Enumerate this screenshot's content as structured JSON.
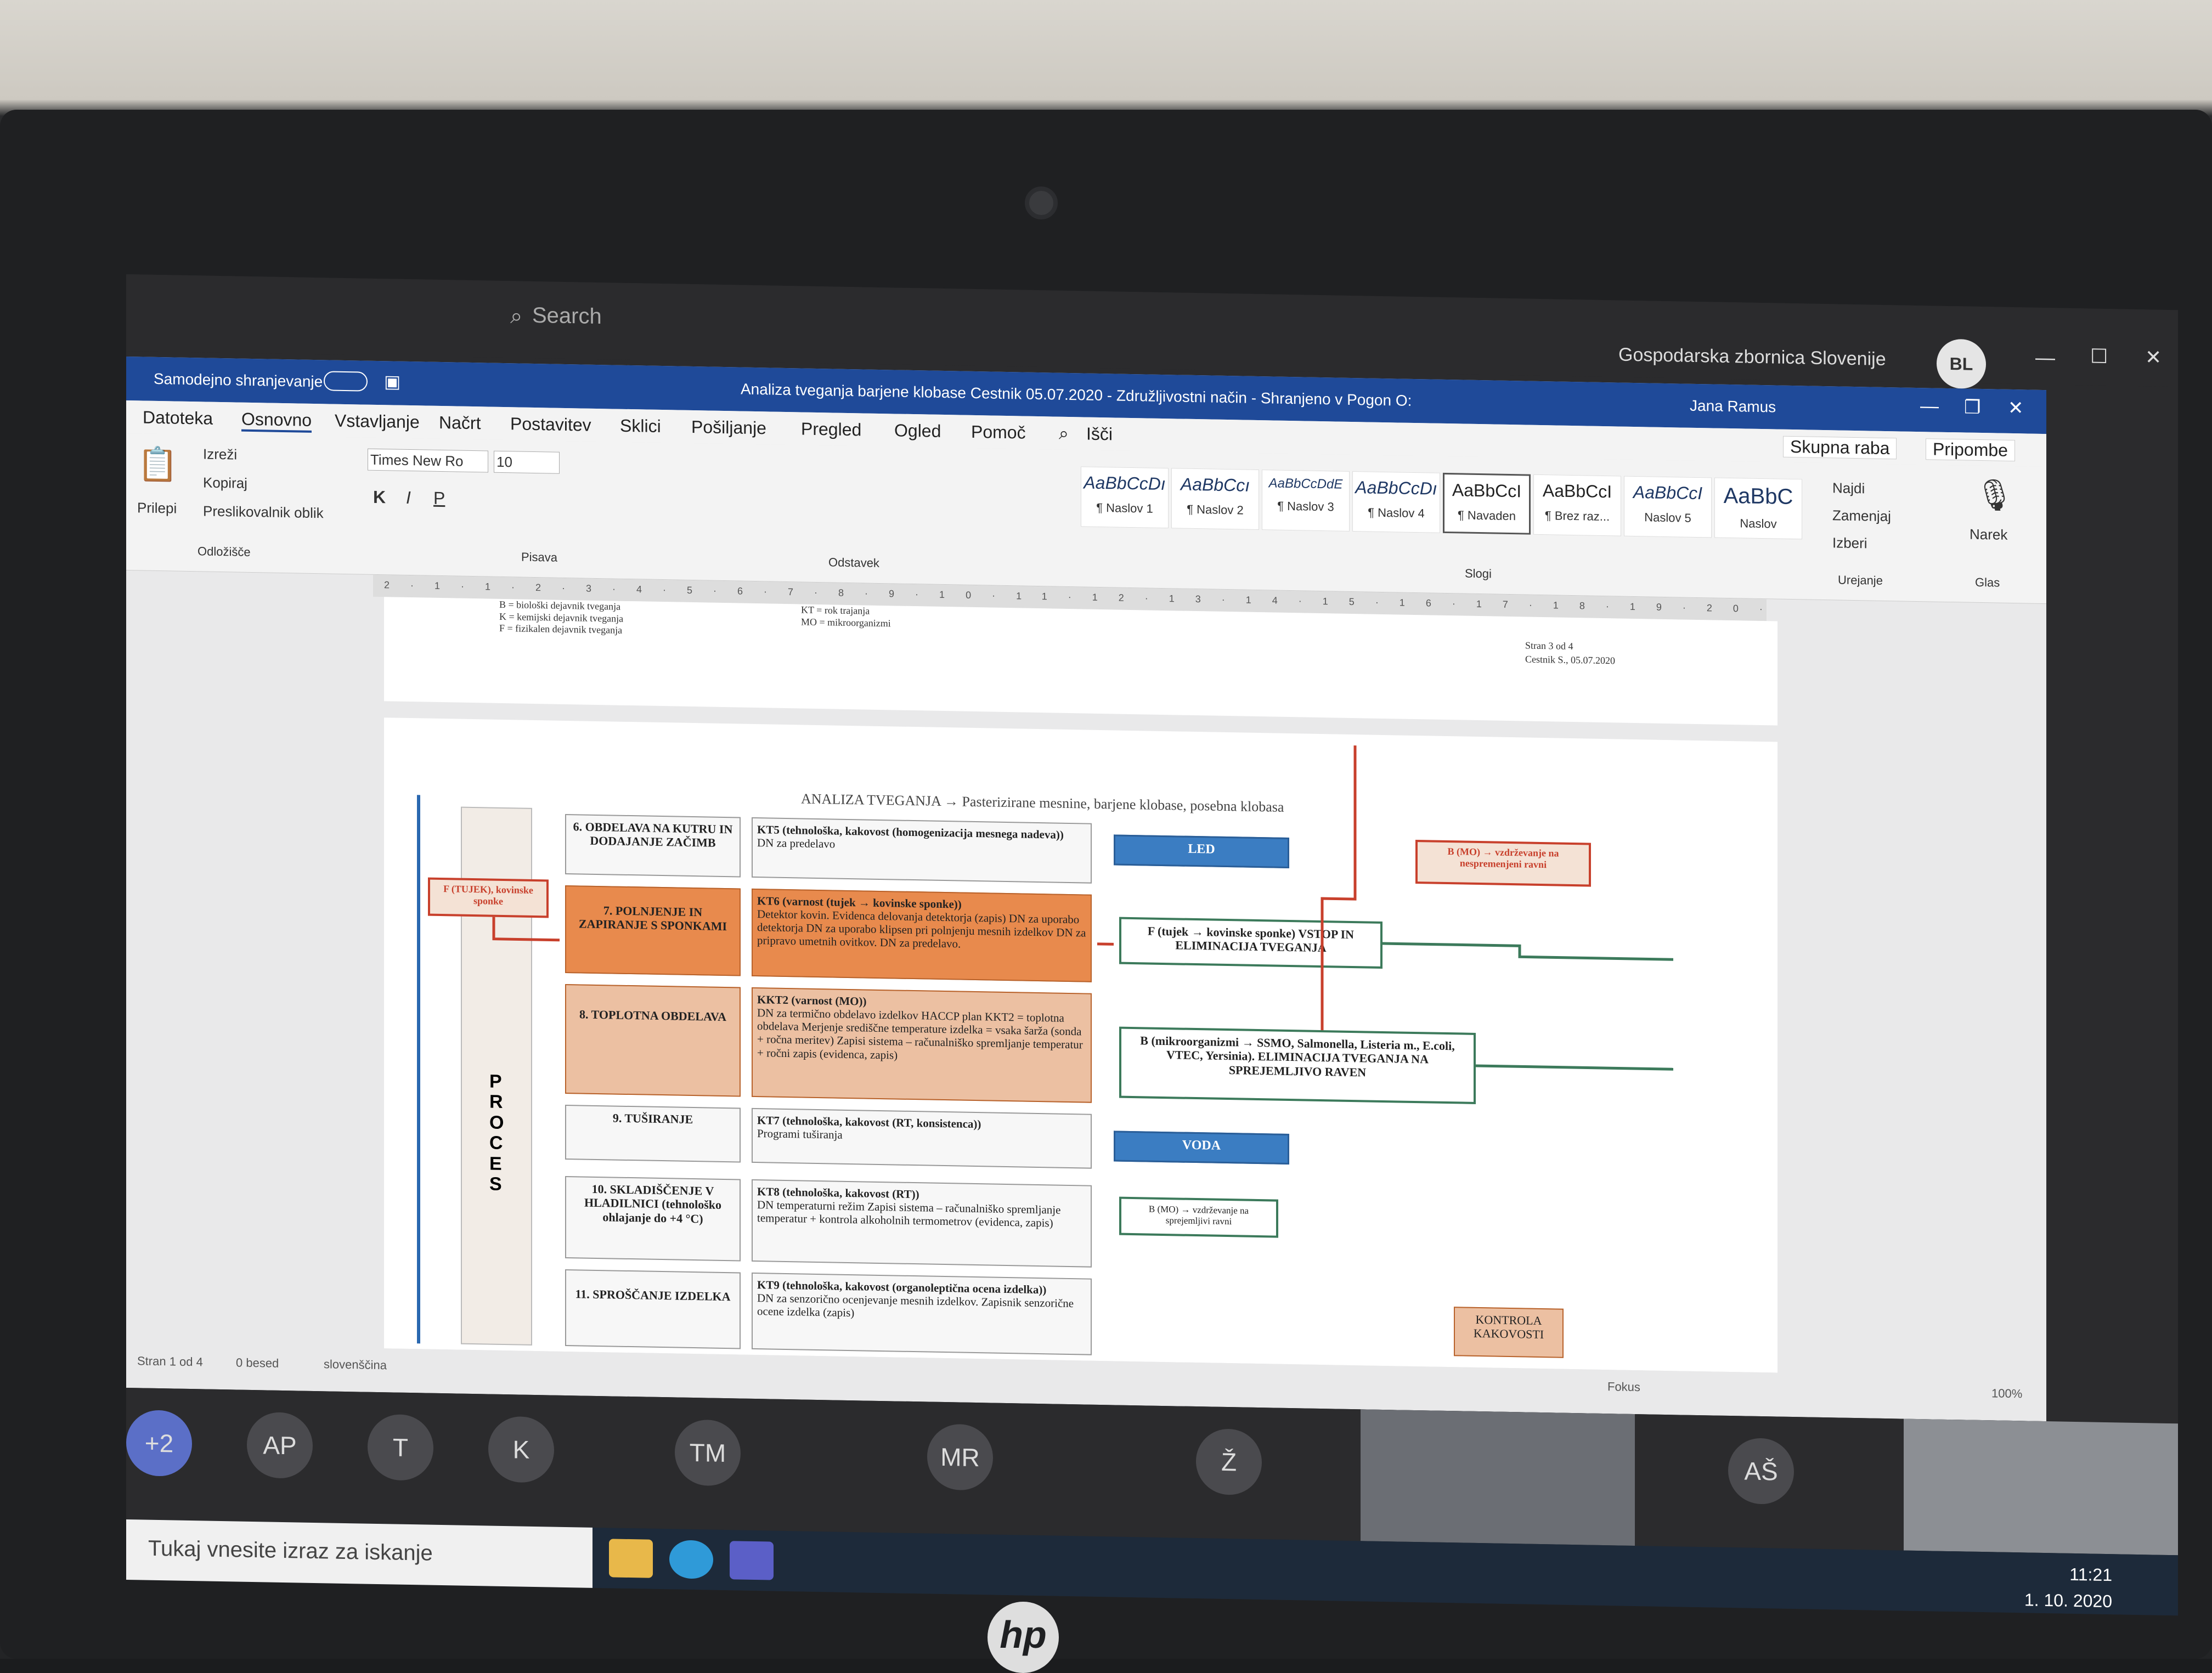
{
  "teams": {
    "search_placeholder": "Search",
    "org_name": "Gospodarska zbornica Slovenije",
    "user_initials": "BL"
  },
  "word": {
    "autosave_label": "Samodejno shranjevanje",
    "doc_title": "Analiza tveganja barjene klobase Cestnik 05.07.2020 - Združljivostni način - Shranjeno v Pogon O:",
    "user_name": "Jana Ramus",
    "menu": [
      "Datoteka",
      "Osnovno",
      "Vstavljanje",
      "Načrt",
      "Postavitev",
      "Sklici",
      "Pošiljanje",
      "Pregled",
      "Ogled",
      "Pomoč",
      "Išči"
    ],
    "share_label": "Skupna raba",
    "comments_label": "Pripombe",
    "clipboard": {
      "paste": "Prilepi",
      "cut": "Izreži",
      "copy": "Kopiraj",
      "format_painter": "Preslikovalnik oblik",
      "group": "Odložišče"
    },
    "font": {
      "name": "Times New Ro",
      "size": "10",
      "group": "Pisava"
    },
    "paragraph_group": "Odstavek",
    "styles": [
      {
        "preview": "AaBbCcDı",
        "name": "¶ Naslov 1"
      },
      {
        "preview": "AaBbCcı",
        "name": "¶ Naslov 2"
      },
      {
        "preview": "AaBbCcDdE",
        "name": "¶ Naslov 3"
      },
      {
        "preview": "AaBbCcDı",
        "name": "¶ Naslov 4"
      },
      {
        "preview": "AaBbCcI",
        "name": "¶ Navaden"
      },
      {
        "preview": "AaBbCcI",
        "name": "¶ Brez raz..."
      },
      {
        "preview": "AaBbCcI",
        "name": "Naslov 5"
      },
      {
        "preview": "AaBbC",
        "name": "Naslov"
      }
    ],
    "styles_group": "Slogi",
    "editing": {
      "find": "Najdi",
      "replace": "Zamenjaj",
      "select": "Izberi",
      "group": "Urejanje"
    },
    "voice": {
      "dictate": "Narek",
      "group": "Glas"
    },
    "page1": {
      "legend": [
        "B = biološki dejavnik tveganja",
        "K = kemijski dejavnik tveganja",
        "F = fizikalen dejavnik tveganja"
      ],
      "legend2": [
        "KT = rok trajanja",
        "MO = mikroorganizmi"
      ],
      "page_info": "Stran 3 od 4",
      "author_date": "Cestnik S., 05.07.2020"
    },
    "diagram": {
      "title": "ANALIZA TVEGANJA → Pasterizirane mesnine, barjene klobase, posebna klobasa",
      "process_label": "P R O C E S",
      "steps": [
        "6. OBDELAVA NA KUTRU IN DODAJANJE ZAČIMB",
        "7. POLNJENJE IN ZAPIRANJE S SPONKAMI",
        "8. TOPLOTNA OBDELAVA",
        "9. TUŠIRANJE",
        "10. SKLADIŠČENJE V HLADILNICI (tehnološko ohlajanje do +4 °C)",
        "11. SPROŠČANJE IZDELKA"
      ],
      "kt": [
        {
          "title": "KT5 (tehnološka, kakovost (homogenizacija mesnega nadeva))",
          "body": "DN za predelavo"
        },
        {
          "title": "KT6 (varnost (tujek → kovinske sponke))",
          "body": "Detektor kovin. Evidenca delovanja detektorja (zapis) DN za uporabo detektorja DN za uporabo klipsen pri polnjenju mesnih izdelkov DN za pripravo umetnih ovitkov. DN za predelavo."
        },
        {
          "title": "KKT2 (varnost (MO))",
          "body": "DN za termično obdelavo izdelkov HACCP plan KKT2 = toplotna obdelava Merjenje središčne temperature izdelka = vsaka šarža (sonda + ročna meritev) Zapisi sistema – računalniško spremljanje temperatur + ročni zapis (evidenca, zapis)"
        },
        {
          "title": "KT7 (tehnološka, kakovost (RT, konsistenca))",
          "body": "Programi tuširanja"
        },
        {
          "title": "KT8 (tehnološka, kakovost (RT))",
          "body": "DN temperaturni režim Zapisi sistema – računalniško spremljanje temperatur + kontrola alkoholnih termometrov (evidenca, zapis)"
        },
        {
          "title": "KT9 (tehnološka, kakovost (organoleptična ocena izdelka))",
          "body": "DN za senzorično ocenjevanje mesnih izdelkov. Zapisnik senzorične ocene izdelka (zapis)"
        }
      ],
      "hazard_left": "F (TUJEK), kovinske sponke",
      "led": "LED",
      "voda": "VODA",
      "f_box": "F (tujek → kovinske sponke) VSTOP IN ELIMINACIJA TVEGANJA",
      "b_box": "B (mikroorganizmi → SSMO, Salmonella, Listeria m., E.coli, VTEC, Yersinia). ELIMINACIJA TVEGANJA NA SPREJEMLJIVO RAVEN",
      "b_mo_top": "B (MO) → vzdrževanje na nespremenjeni ravni",
      "b_mo_low": "B (MO) → vzdrževanje na sprejemljivi ravni",
      "kontrola": "KONTROLA KAKOVOSTI"
    },
    "status": {
      "page": "Stran 1 od 4",
      "words": "0 besed",
      "lang": "slovenščina",
      "focus": "Fokus",
      "zoom": "100%"
    }
  },
  "participants": [
    "+2",
    "AP",
    "T",
    "K",
    "TM",
    "MR",
    "Ž",
    "AŠ"
  ],
  "taskbar": {
    "search_placeholder": "Tukaj vnesite izraz za iskanje",
    "time": "11:21",
    "date": "1. 10. 2020"
  },
  "brand": "hp"
}
